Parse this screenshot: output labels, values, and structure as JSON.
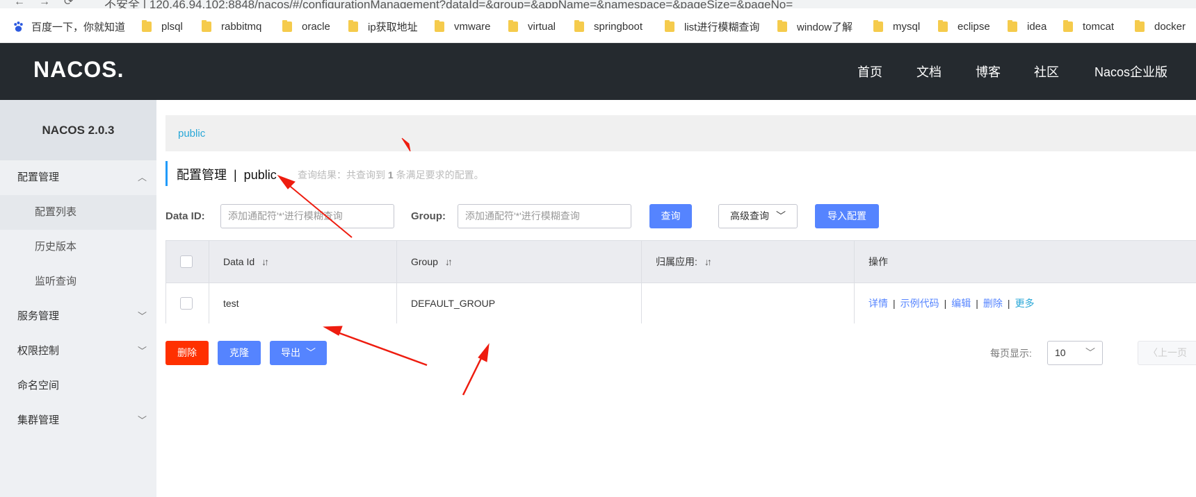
{
  "browser": {
    "url": "不安全 | 120.46.94.102:8848/nacos/#/configurationManagement?dataId=&group=&appName=&namespace=&pageSize=&pageNo=",
    "bookmarks": [
      "百度一下，你就知道",
      "plsql",
      "rabbitmq",
      "oracle",
      "ip获取地址",
      "vmware",
      "virtual",
      "springboot",
      "list进行模糊查询",
      "window了解",
      "mysql",
      "eclipse",
      "idea",
      "tomcat",
      "docker"
    ]
  },
  "header": {
    "logo": "NACOS.",
    "nav": [
      "首页",
      "文档",
      "博客",
      "社区",
      "Nacos企业版"
    ]
  },
  "sidebar": {
    "version": "NACOS 2.0.3",
    "items": [
      {
        "label": "配置管理",
        "chevron": "up"
      },
      {
        "label": "配置列表"
      },
      {
        "label": "历史版本"
      },
      {
        "label": "监听查询"
      },
      {
        "label": "服务管理",
        "chevron": "down"
      },
      {
        "label": "权限控制",
        "chevron": "down"
      },
      {
        "label": "命名空间"
      },
      {
        "label": "集群管理",
        "chevron": "down"
      }
    ]
  },
  "main": {
    "namespace_tab": "public",
    "title": "配置管理  |  public",
    "result_prefix": "查询结果：共查询到",
    "result_count": "1",
    "result_suffix": "条满足要求的配置。",
    "search": {
      "dataid_label": "Data ID:",
      "dataid_placeholder": "添加通配符'*'进行模糊查询",
      "group_label": "Group:",
      "group_placeholder": "添加通配符'*'进行模糊查询",
      "query_button": "查询",
      "advanced_button": "高级查询",
      "import_button": "导入配置"
    },
    "table": {
      "headers": [
        "Data Id",
        "Group",
        "归属应用:",
        "操作"
      ],
      "rows": [
        {
          "data_id": "test",
          "group": "DEFAULT_GROUP",
          "app": ""
        }
      ],
      "ops": [
        "详情",
        "示例代码",
        "编辑",
        "删除",
        "更多"
      ]
    },
    "footer": {
      "delete_button": "删除",
      "clone_button": "克隆",
      "export_button": "导出",
      "page_size_label": "每页显示:",
      "page_size_value": "10",
      "prev_button": "上一页"
    }
  },
  "colors": {
    "header_bg": "#252a2f",
    "primary": "#5584ff",
    "danger": "#ff3000",
    "link": "#28a7d7",
    "annotation_arrow": "#ee1c0f"
  }
}
